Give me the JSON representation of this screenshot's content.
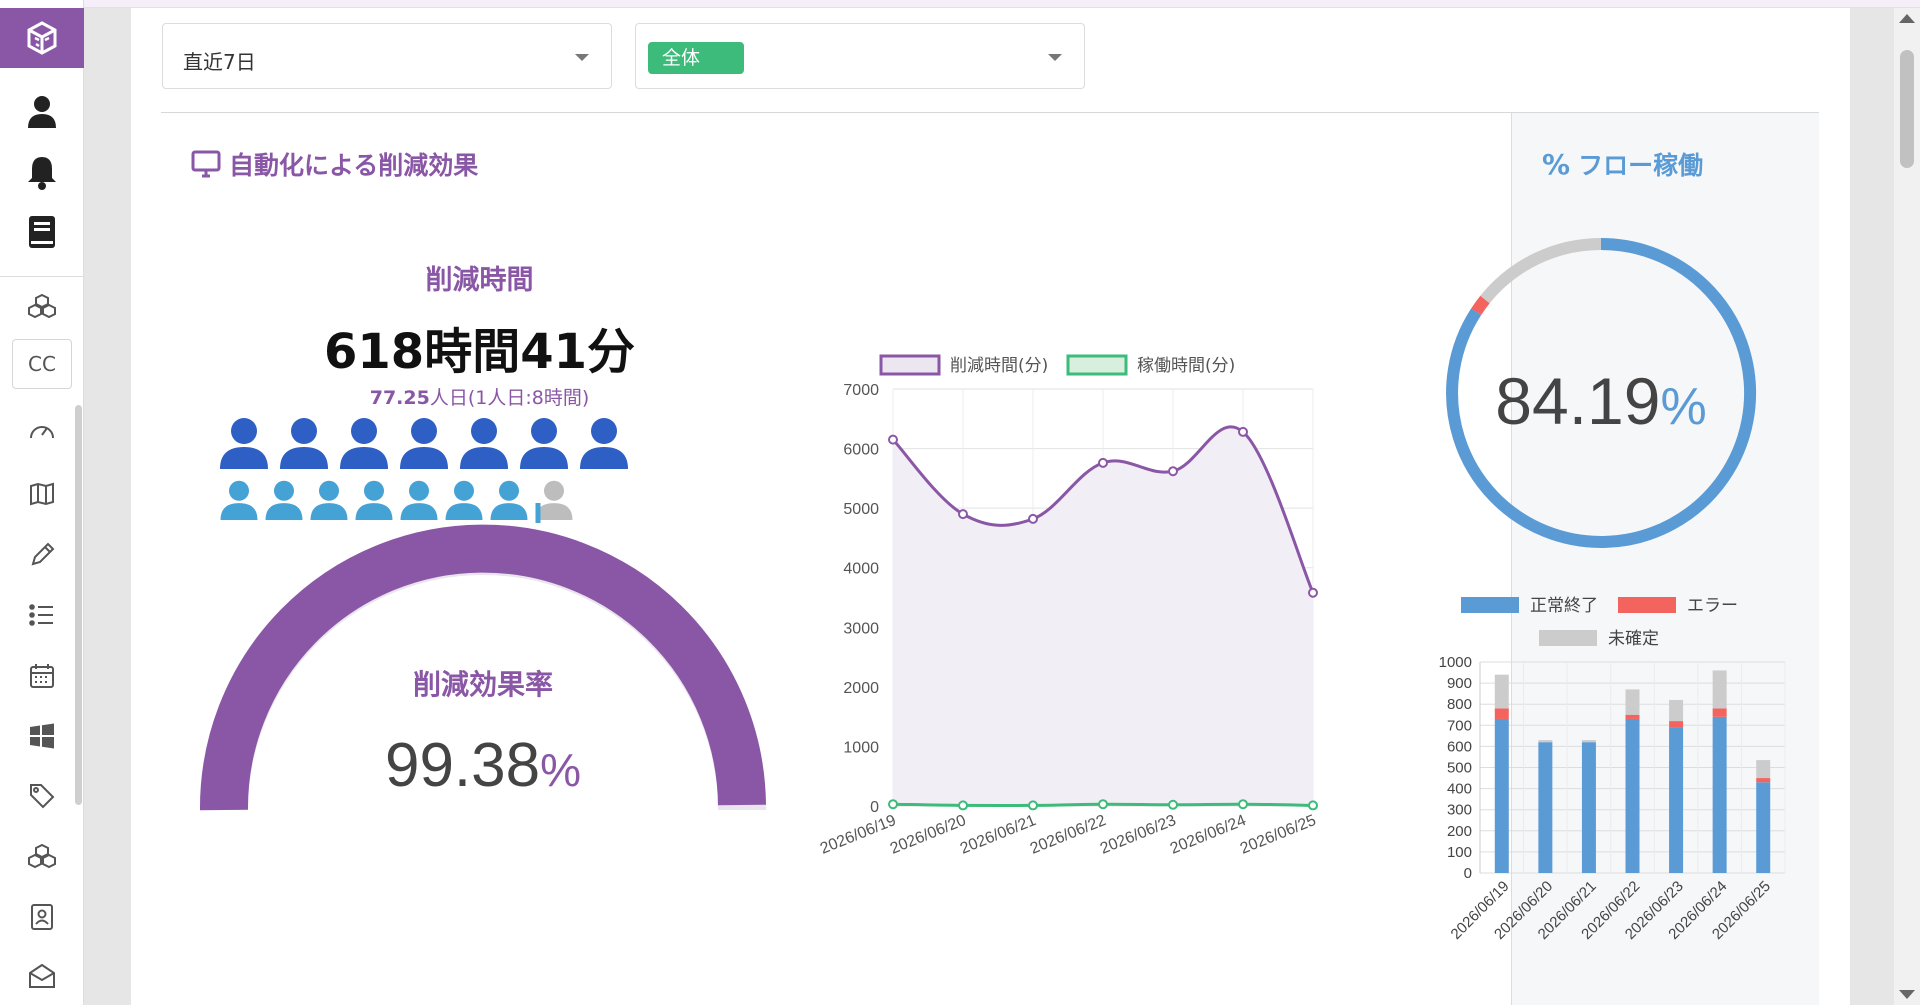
{
  "filters": {
    "period": {
      "value": "直近7日"
    },
    "scope": {
      "value": "全体"
    }
  },
  "reduction": {
    "section_title": "自動化による削減効果",
    "time_label": "削減時間",
    "time_value": "618時間41分",
    "man_days_number": "77.25",
    "man_days_suffix": "人日(1人日:8時間)",
    "rate_label": "削減効果率",
    "rate_value": "99.38",
    "rate_unit": "%"
  },
  "flow": {
    "section_title": "フロー稼働",
    "rate_value": "84.19",
    "rate_unit": "%"
  },
  "colors": {
    "purple": "#8a57a6",
    "green": "#3dbb7a",
    "blue": "#5a9bd5",
    "red": "#f4645f",
    "gray": "#cccccc",
    "person_dark": "#2e5fc4",
    "person_light": "#45a2d5"
  },
  "chart_data": [
    {
      "type": "line",
      "x": [
        "2026/06/19",
        "2026/06/20",
        "2026/06/21",
        "2026/06/22",
        "2026/06/23",
        "2026/06/24",
        "2026/06/25"
      ],
      "series": [
        {
          "name": "削減時間(分)",
          "values": [
            6150,
            4900,
            4820,
            5760,
            5620,
            6280,
            3580
          ]
        },
        {
          "name": "稼働時間(分)",
          "values": [
            30,
            10,
            10,
            30,
            20,
            30,
            10
          ]
        }
      ],
      "yticks": [
        "0",
        "1000",
        "2000",
        "3000",
        "4000",
        "5000",
        "6000",
        "7000"
      ],
      "ylim": [
        0,
        7000
      ],
      "grid": true,
      "legend": "top"
    },
    {
      "type": "bar",
      "stacked": true,
      "categories": [
        "2026/06/19",
        "2026/06/20",
        "2026/06/21",
        "2026/06/22",
        "2026/06/23",
        "2026/06/24",
        "2026/06/25"
      ],
      "series": [
        {
          "name": "正常終了",
          "values": [
            730,
            620,
            620,
            730,
            690,
            740,
            430
          ]
        },
        {
          "name": "エラー",
          "values": [
            50,
            0,
            0,
            20,
            30,
            40,
            20
          ]
        },
        {
          "name": "未確定",
          "values": [
            160,
            10,
            10,
            120,
            100,
            180,
            85
          ]
        }
      ],
      "yticks": [
        "0",
        "100",
        "200",
        "300",
        "400",
        "500",
        "600",
        "700",
        "800",
        "900",
        "1000"
      ],
      "ylim": [
        0,
        1000
      ],
      "grid": true,
      "legend": "top"
    },
    {
      "type": "pie",
      "note": "flow rate donut",
      "values": [
        84.19,
        1.6,
        14.21
      ],
      "labels": [
        "正常終了",
        "エラー",
        "未確定"
      ]
    },
    {
      "type": "pie",
      "note": "reduction rate half-gauge",
      "values": [
        99.38,
        0.62
      ]
    }
  ]
}
